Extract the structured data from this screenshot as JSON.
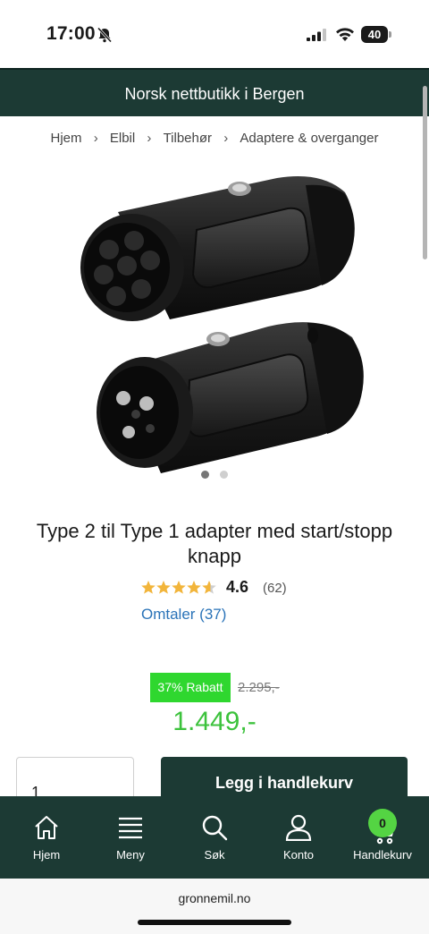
{
  "status_bar": {
    "time": "17:00",
    "battery": "40",
    "icons": [
      "bell-slash-icon",
      "cellular-signal-icon",
      "wifi-icon",
      "battery-icon"
    ]
  },
  "banner": {
    "text": "Norsk nettbutikk i Bergen"
  },
  "breadcrumb": {
    "items": [
      "Hjem",
      "Elbil",
      "Tilbehør",
      "Adaptere & overganger"
    ],
    "separator": "›"
  },
  "gallery": {
    "slide_count": 2,
    "active_slide": 1
  },
  "product": {
    "title": "Type 2 til Type 1 adapter med start/stopp knapp",
    "rating": "4.6",
    "rating_value": 4.6,
    "rating_count": "(62)",
    "reviews_link": "Omtaler (37)",
    "discount": "37% Rabatt",
    "old_price": "2.295,-",
    "new_price": "1.449,-"
  },
  "cart": {
    "quantity": "1",
    "add_label": "Legg i handlekurv"
  },
  "nav": {
    "items": [
      {
        "label": "Hjem",
        "icon": "home-icon"
      },
      {
        "label": "Meny",
        "icon": "menu-icon"
      },
      {
        "label": "Søk",
        "icon": "search-icon"
      },
      {
        "label": "Konto",
        "icon": "user-icon"
      },
      {
        "label": "Handlekurv",
        "icon": "cart-icon"
      }
    ],
    "cart_count": "0"
  },
  "browser": {
    "url": "gronnemil.no"
  },
  "colors": {
    "brand_dark": "#1c3a34",
    "discount_green": "#2fd72f",
    "price_green": "#3cc23c",
    "link_blue": "#2a73b8",
    "star": "#f2b53b",
    "cart_badge": "#54d443"
  }
}
